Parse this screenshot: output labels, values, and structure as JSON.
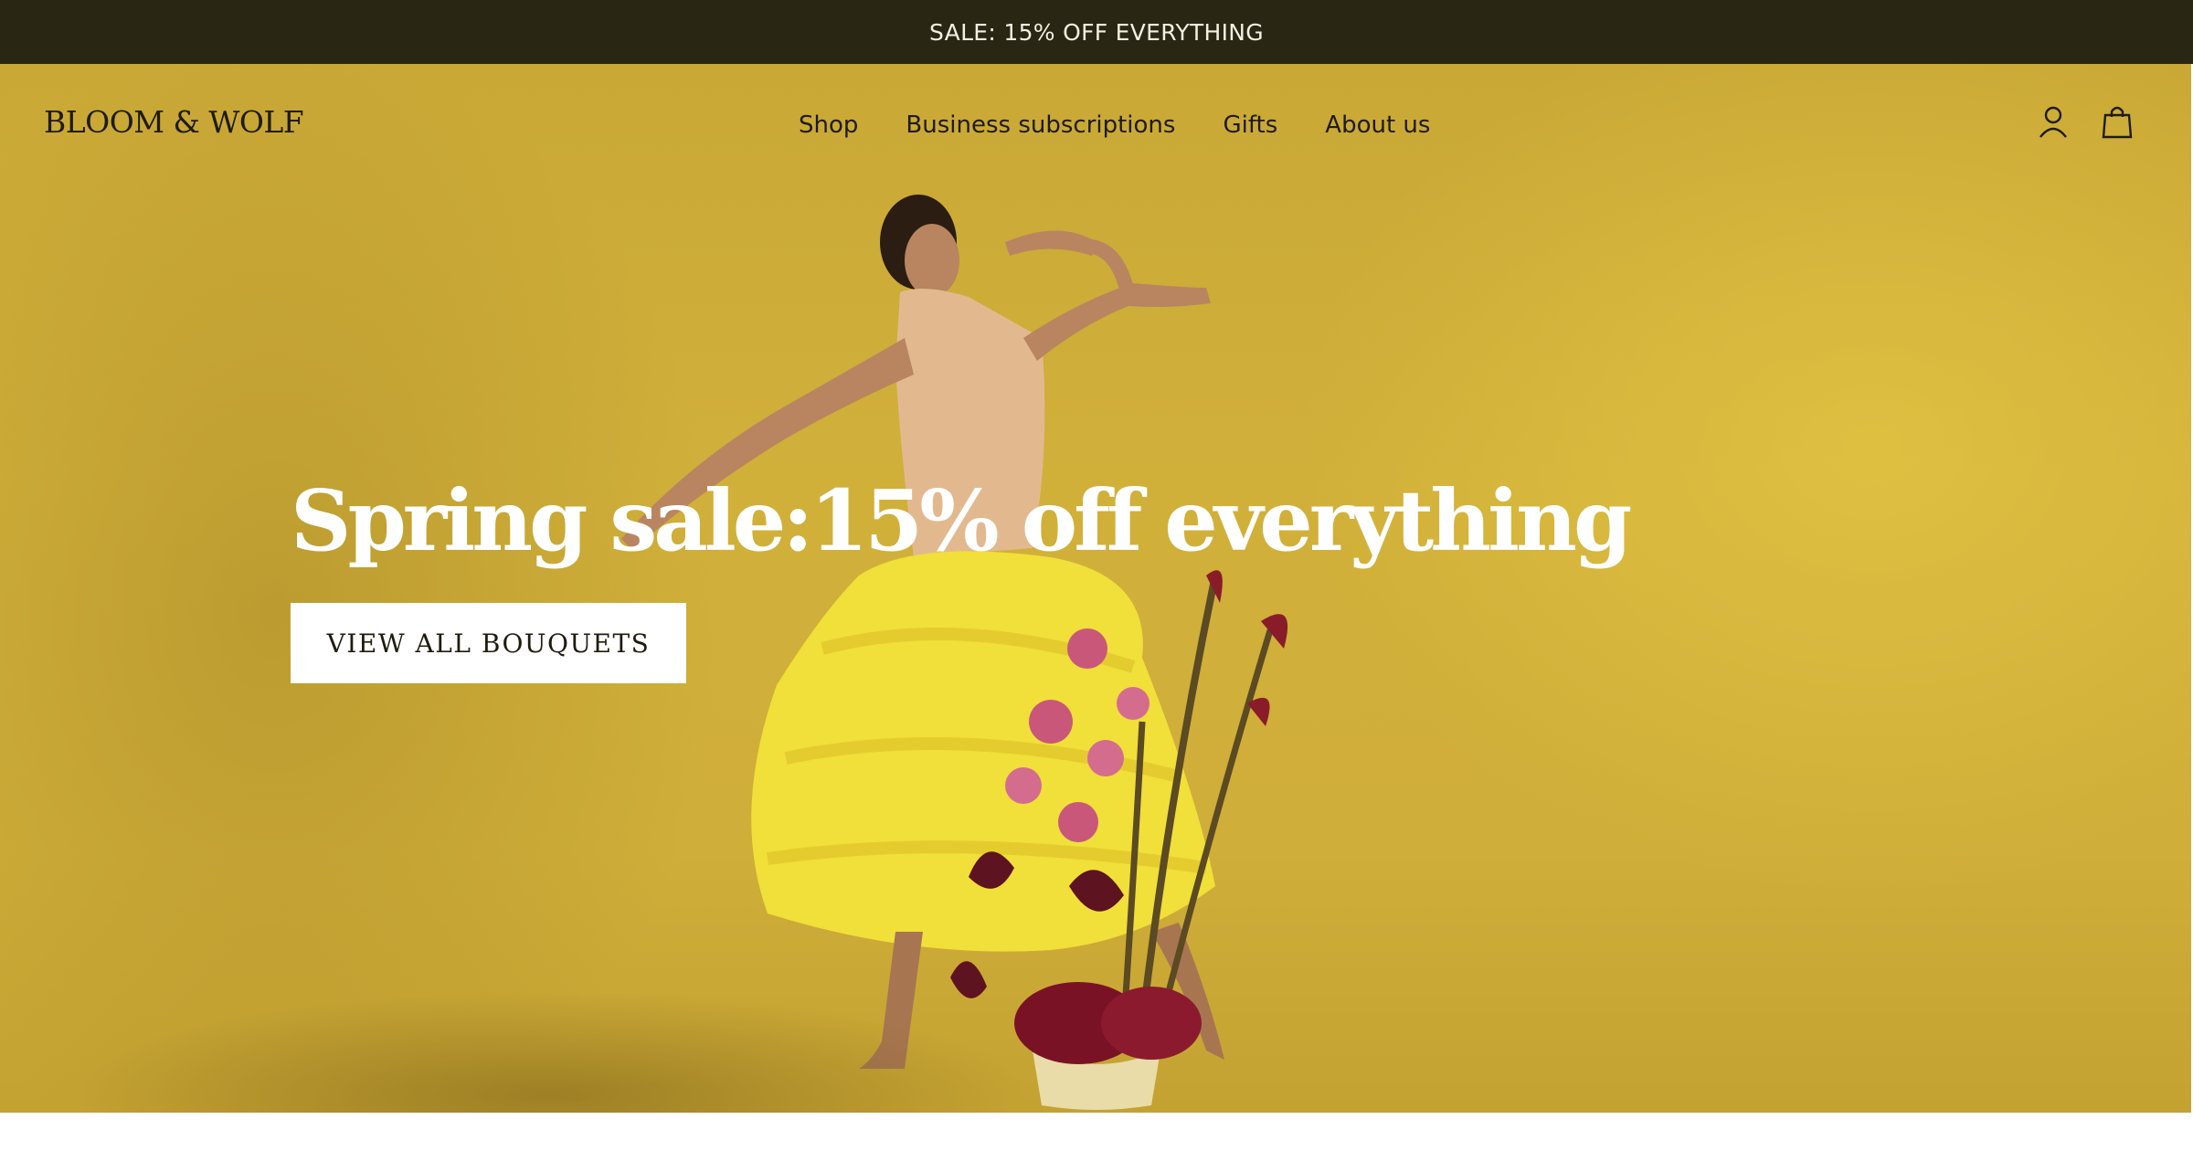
{
  "announcement": {
    "text": "SALE: 15% OFF EVERYTHING"
  },
  "header": {
    "logo": "BLOOM & WOLF",
    "nav": [
      {
        "label": "Shop"
      },
      {
        "label": "Business subscriptions"
      },
      {
        "label": "Gifts"
      },
      {
        "label": "About us"
      }
    ],
    "icons": [
      "account-icon",
      "shopping-bag-icon"
    ]
  },
  "hero": {
    "headline": "Spring sale:15% off everything",
    "cta_label": "VIEW ALL BOUQUETS"
  },
  "colors": {
    "announcement_bg": "#2a2614",
    "hero_bg": "#cfae39",
    "text_dark": "#1f1b0e",
    "cta_bg": "#ffffff"
  }
}
